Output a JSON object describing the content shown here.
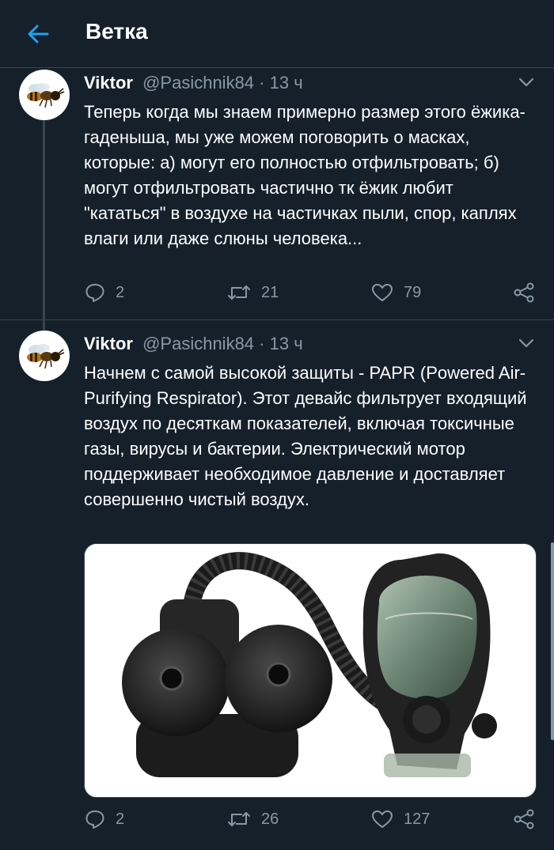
{
  "header": {
    "title": "Ветка"
  },
  "tweets": [
    {
      "name": "Viktor",
      "handle": "@Pasichnik84",
      "separator": "·",
      "time": "13 ч",
      "text": "Теперь когда мы знаем примерно размер этого ёжика-гаденыша, мы уже можем поговорить о масках, которые: а) могут его полностью отфильтровать; б) могут отфильтровать частично тк ёжик любит \"кататься\" в воздухе на частичках пыли, спор, каплях влаги или даже слюны человека...",
      "replies": "2",
      "retweets": "21",
      "likes": "79"
    },
    {
      "name": "Viktor",
      "handle": "@Pasichnik84",
      "separator": "·",
      "time": "13 ч",
      "text": "Начнем с самой высокой защиты - PAPR (Powered Air-Purifying Respirator). Этот девайс фильтрует входящий воздух по десяткам показателей, включая токсичные газы, вирусы и бактерии. Электрический мотор поддерживает необходимое давление и доставляет совершенно чистый воздух.",
      "replies": "2",
      "retweets": "26",
      "likes": "127"
    }
  ],
  "colors": {
    "background": "#15202b",
    "accent": "#1da1f2",
    "muted": "#8899a6",
    "border": "#38444d"
  },
  "icons": [
    "back-arrow-icon",
    "chevron-down-icon",
    "reply-icon",
    "retweet-icon",
    "like-icon",
    "share-icon"
  ]
}
